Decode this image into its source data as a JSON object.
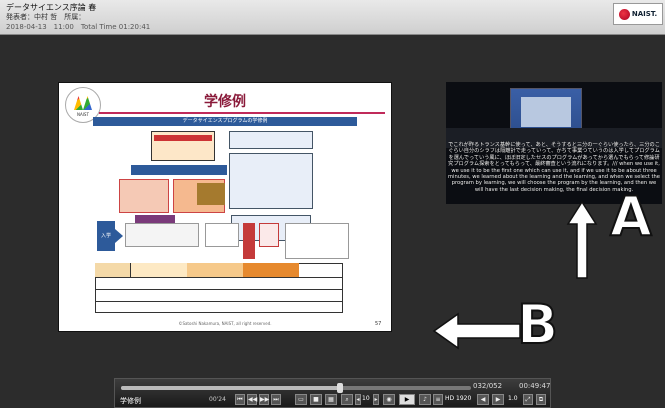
{
  "header": {
    "title": "データサイエンス序論 春",
    "presenter": "発表者：中村 哲　所属：",
    "datetime": "2018-04-13　11:00　Total Time  01:20:41",
    "logo_text": "NAIST."
  },
  "slide": {
    "logo_text": "NAIST",
    "title": "学修例",
    "subtitle": "データサイエンスプログラムの学修例",
    "footer": "©Satoshi Nakamura, NAIST, all right reserved.",
    "page": "57",
    "labels": {
      "enter": "入学",
      "col_a": "データ自動収集",
      "col_b": "データ分析",
      "col_c": "データ活用"
    }
  },
  "video": {
    "caption": "でこれが昨るトランス基幹に使って、あと、そうすると三分の一ぐらい使ったら、三分のこぐらい自分のシラフは隔離計で走っていって、かちて事業つていうのは入学してプログラムを選んでっていう風に、ほぼ旧定したセスのプログラムがあってから選んでもらって修論研究プログラム探索をとってもらって、最終審査という流れになります。/// when we use it, we use it to be the first one which can use it, and if we use it to be about three minutes, we learned about the learning and the learning, and when we select the program by learning, we will choose the program by the learning, and then we will have the last decision making, the final decision making."
  },
  "annotations": {
    "label_a": "A",
    "label_b": "B"
  },
  "controls": {
    "label": "学修例",
    "current_time": "00'24",
    "slide_counter": "032/052",
    "total_time": "00:49:47",
    "zoom_value": "10",
    "hd": "HD 1920",
    "speed": "1.0"
  }
}
